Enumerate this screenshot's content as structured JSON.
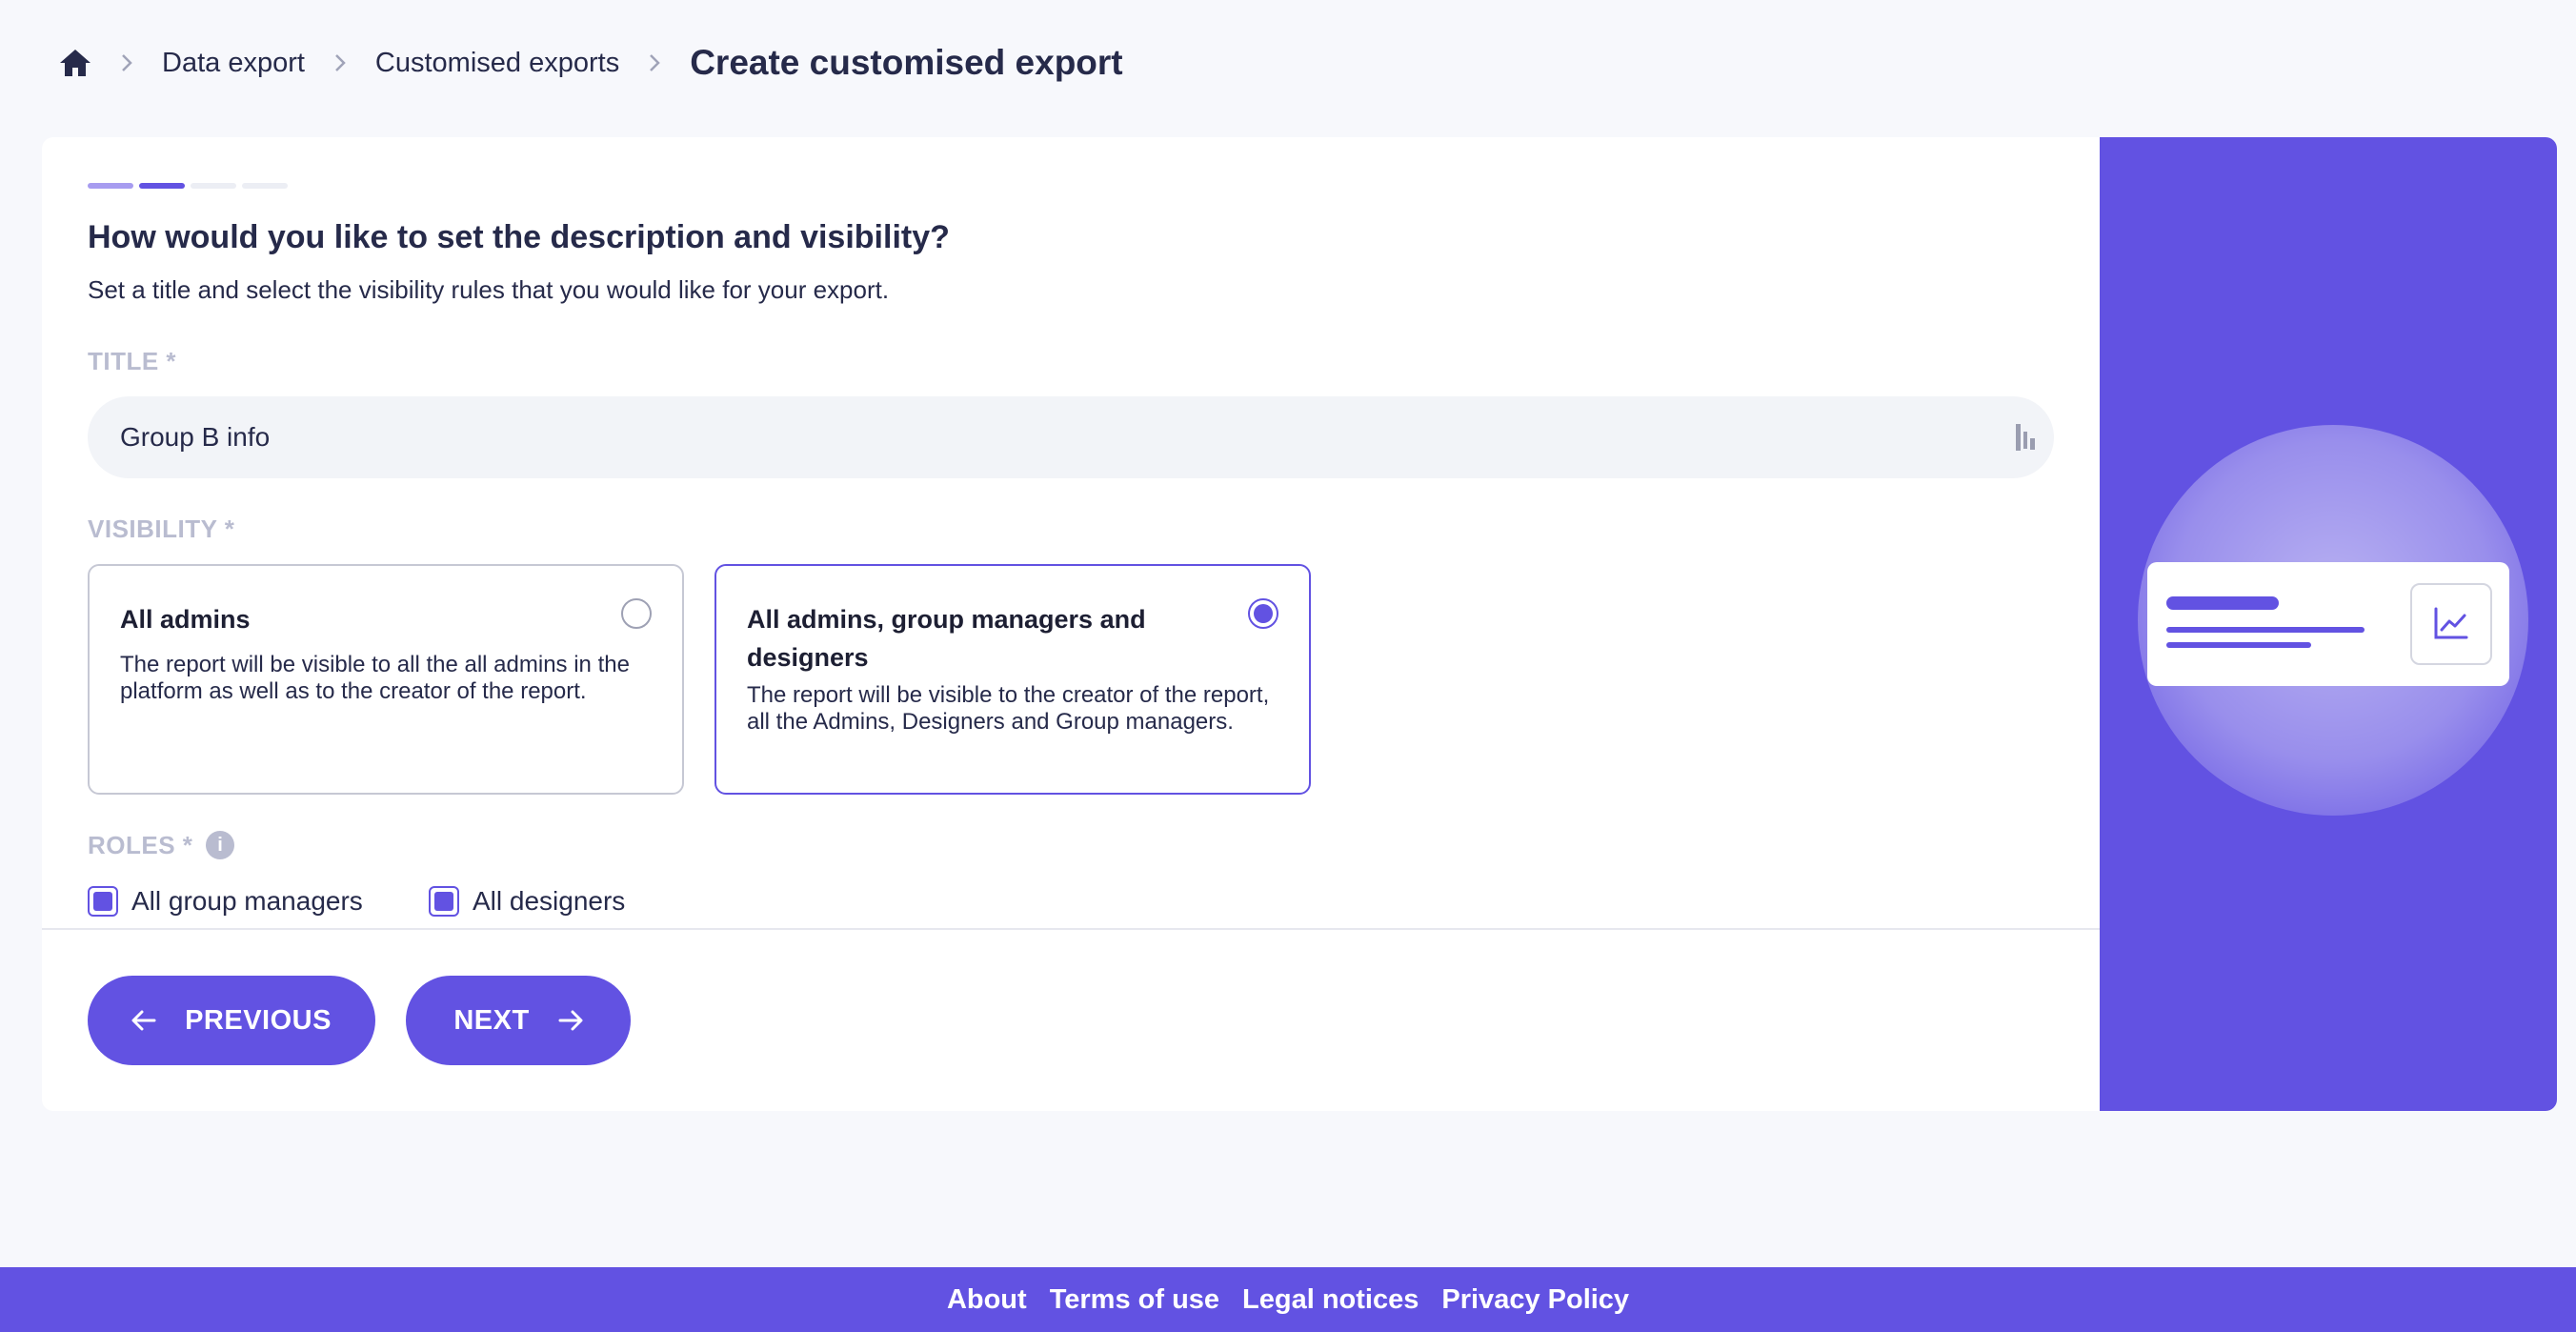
{
  "breadcrumb": {
    "home_icon": "home-icon",
    "items": [
      "Data export",
      "Customised exports"
    ],
    "current": "Create customised export",
    "separator": "›"
  },
  "stepper": {
    "steps": 4,
    "current_step": 2,
    "colors": {
      "done": "#a79cf0",
      "active": "#6252e2",
      "todo": "#eceef4"
    }
  },
  "form": {
    "question": "How would you like to set the description and visibility?",
    "subtitle": "Set a title and select the visibility rules that you would like for your export.",
    "title_label": "TITLE *",
    "title_value": "Group B info",
    "visibility_label": "VISIBILITY *",
    "visibility_options": [
      {
        "title": "All admins",
        "description": "The report will be visible to all the all admins in the platform as well as to the creator of the report.",
        "selected": false
      },
      {
        "title": "All admins, group managers and designers",
        "description": "The report will be visible to the creator of the report, all the Admins, Designers and Group managers.",
        "selected": true
      }
    ],
    "roles_label": "ROLES *",
    "roles_info_icon": "info-icon",
    "roles": [
      {
        "label": "All group managers",
        "checked": true
      },
      {
        "label": "All designers",
        "checked": true
      }
    ]
  },
  "buttons": {
    "previous": "PREVIOUS",
    "next": "NEXT"
  },
  "footer": {
    "links": [
      "About",
      "Terms of use",
      "Legal notices",
      "Privacy Policy"
    ]
  },
  "colors": {
    "accent": "#6252e2",
    "background": "#f7f8fc",
    "label_muted": "#b9bcd0",
    "text": "#262a4a"
  }
}
